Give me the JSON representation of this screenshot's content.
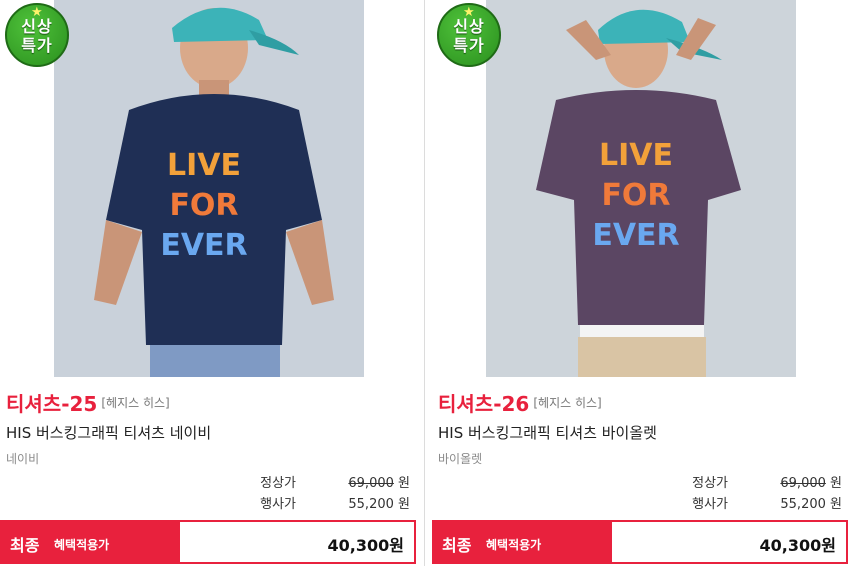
{
  "products": [
    {
      "badge": {
        "line1": "신상",
        "line2": "특가"
      },
      "code": "티셔츠-25",
      "brand": "[헤지스 히스]",
      "title": "HIS 버스킹그래픽 티셔츠 네이비",
      "color": "네이비",
      "regular_label": "정상가",
      "regular_price": "69,000",
      "sale_label": "행사가",
      "sale_price": "55,200",
      "currency": "원",
      "final_label": "최종",
      "final_sub": "혜택적용가",
      "final_price": "40,300원",
      "shirt_print": [
        "LIVE",
        "FOR",
        "EVER"
      ],
      "shirt_color": "#1f2f55"
    },
    {
      "badge": {
        "line1": "신상",
        "line2": "특가"
      },
      "code": "티셔츠-26",
      "brand": "[헤지스 히스]",
      "title": "HIS 버스킹그래픽 티셔츠 바이올렛",
      "color": "바이올렛",
      "regular_label": "정상가",
      "regular_price": "69,000",
      "sale_label": "행사가",
      "sale_price": "55,200",
      "currency": "원",
      "final_label": "최종",
      "final_sub": "혜택적용가",
      "final_price": "40,300원",
      "shirt_print": [
        "LIVE",
        "FOR",
        "EVER"
      ],
      "shirt_color": "#5b4663"
    }
  ],
  "accent_color": "#e8213d",
  "badge_color": "#3aa62a"
}
